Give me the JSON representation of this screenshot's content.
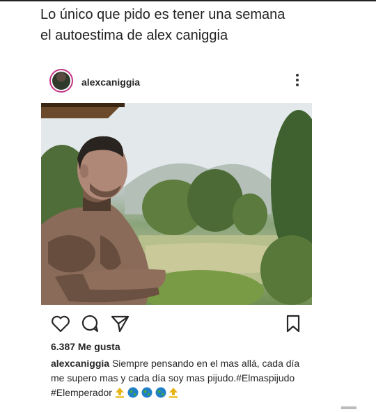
{
  "meme": {
    "line1": "Lo único que pido es tener una semana",
    "line2": "el autoestima de alex caniggia"
  },
  "post": {
    "username": "alexcaniggia",
    "likes": "6.387 Me gusta",
    "caption_user": "alexcaniggia",
    "caption_text": "Siempre pensando en el mas allá,  cada día me supero mas y cada día soy mas pijudo.",
    "hashtags": "#Elmaspijudo #Elemperador"
  },
  "icons": {
    "more": "more-options-icon",
    "like": "heart-icon",
    "comment": "comment-bubble-icon",
    "share": "paper-plane-icon",
    "save": "bookmark-icon",
    "top": "top-arrow-emoji",
    "globe": "globe-emoji"
  },
  "colors": {
    "text": "#262626",
    "ring": "#c13584",
    "background": "#ffffff"
  }
}
